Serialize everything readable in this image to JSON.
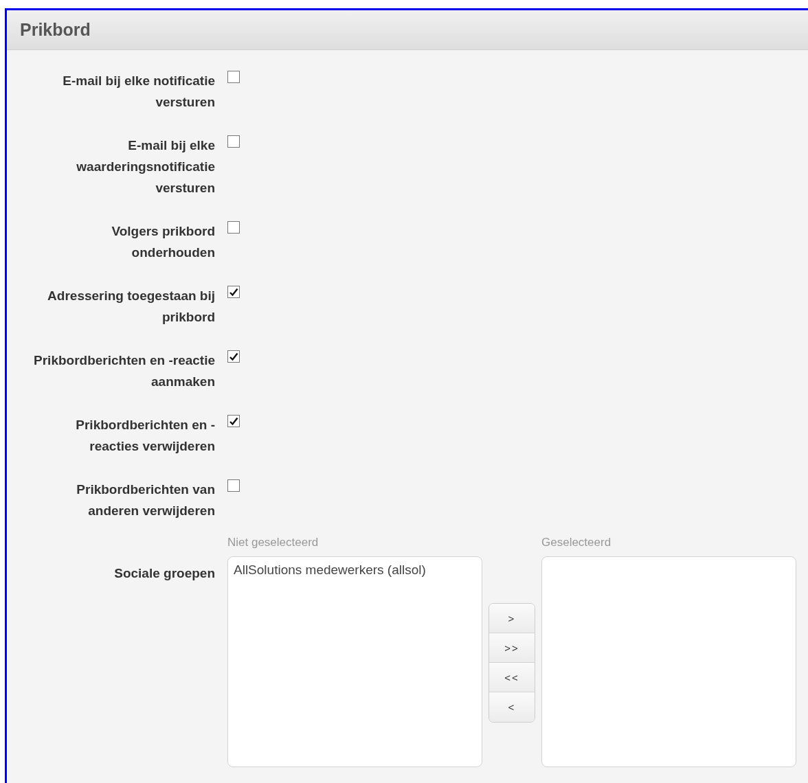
{
  "panel": {
    "title": "Prikbord"
  },
  "settings": [
    {
      "label_lines": [
        "E-mail bij elke notificatie",
        "versturen"
      ],
      "checked": false
    },
    {
      "label_lines": [
        "E-mail bij elke",
        "waarderingsnotificatie",
        "versturen"
      ],
      "checked": false
    },
    {
      "label_lines": [
        "Volgers prikbord",
        "onderhouden"
      ],
      "checked": false
    },
    {
      "label_lines": [
        "Adressering toegestaan bij",
        "prikbord"
      ],
      "checked": true
    },
    {
      "label_lines": [
        "Prikbordberichten en -reactie",
        "aanmaken"
      ],
      "checked": true
    },
    {
      "label_lines": [
        "Prikbordberichten en -",
        "reacties verwijderen"
      ],
      "checked": true
    },
    {
      "label_lines": [
        "Prikbordberichten van",
        "anderen verwijderen"
      ],
      "checked": false
    }
  ],
  "picker": {
    "label": "Sociale groepen",
    "available": {
      "caption": "Niet geselecteerd",
      "items": [
        "AllSolutions medewerkers (allsol)"
      ]
    },
    "buttons": [
      ">",
      ">>",
      "<<",
      "<"
    ],
    "selected": {
      "caption": "Geselecteerd"
    }
  }
}
